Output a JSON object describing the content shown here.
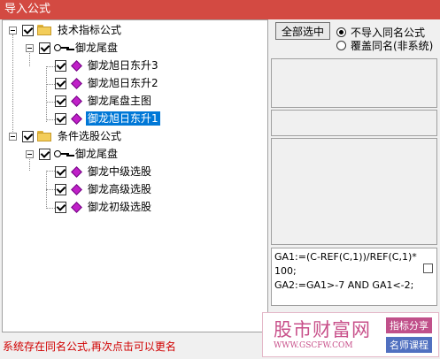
{
  "window": {
    "title": "导入公式"
  },
  "tree": {
    "groups": [
      {
        "label": "技术指标公式",
        "checked": true,
        "sub": {
          "label": "御龙尾盘",
          "checked": true,
          "items": [
            {
              "label": "御龙旭日东升3",
              "checked": true,
              "selected": false
            },
            {
              "label": "御龙旭日东升2",
              "checked": true,
              "selected": false
            },
            {
              "label": "御龙尾盘主图",
              "checked": true,
              "selected": false
            },
            {
              "label": "御龙旭日东升1",
              "checked": true,
              "selected": true
            }
          ]
        }
      },
      {
        "label": "条件选股公式",
        "checked": true,
        "sub": {
          "label": "御龙尾盘",
          "checked": true,
          "items": [
            {
              "label": "御龙中级选股",
              "checked": true,
              "selected": false
            },
            {
              "label": "御龙高级选股",
              "checked": true,
              "selected": false
            },
            {
              "label": "御龙初级选股",
              "checked": true,
              "selected": false
            }
          ]
        }
      }
    ]
  },
  "controls": {
    "select_all_label": "全部选中",
    "options": [
      {
        "label": "不导入同名公式",
        "selected": true
      },
      {
        "label": "覆盖同名(非系统)",
        "selected": false
      }
    ]
  },
  "formula": {
    "text": "GA1:=(C-REF(C,1))/REF(C,1)*100;\nGA2:=GA1>-7 AND GA1<-2;"
  },
  "status_message": "系统存在同名公式,再次点击可以更名",
  "watermark": {
    "brand": "股市财富网",
    "url": "WWW.GSCFW.COM",
    "tag1": "指标分享",
    "tag2": "名师课程"
  },
  "colors": {
    "titlebar": "#d34a42",
    "selection": "#0078d7",
    "status_text": "#d00000"
  }
}
